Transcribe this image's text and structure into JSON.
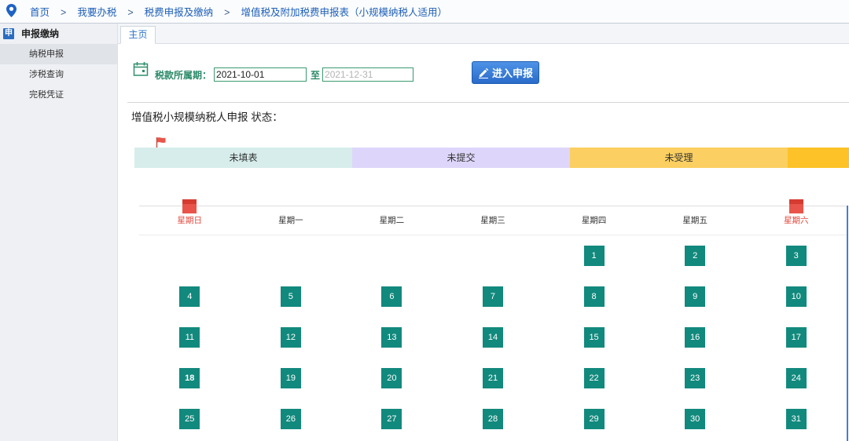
{
  "breadcrumb": {
    "icon": "location-pin-icon",
    "items": [
      "首页",
      "我要办税",
      "税费申报及缴纳",
      "增值税及附加税费申报表（小规模纳税人适用）"
    ],
    "separator": ">"
  },
  "sidebar": {
    "header": {
      "icon_text": "申",
      "label": "申报缴纳"
    },
    "items": [
      {
        "label": "纳税申报",
        "selected": true
      },
      {
        "label": "涉税查询",
        "selected": false
      },
      {
        "label": "完税凭证",
        "selected": false
      }
    ]
  },
  "tabs": [
    {
      "label": "主页",
      "active": true
    }
  ],
  "period": {
    "icon": "calendar-icon",
    "label": "税款所属期：",
    "start": "2021-10-01",
    "to_label": "至",
    "end": "2021-12-31",
    "end_disabled": true
  },
  "declare_button": {
    "icon": "edit-icon",
    "label": "进入申报"
  },
  "status": {
    "title": "增值税小规模纳税人申报 状态：",
    "marker_icon": "flag-icon",
    "steps": [
      {
        "label": "未填表",
        "color": "#d6edeb"
      },
      {
        "label": "未提交",
        "color": "#ded6fa"
      },
      {
        "label": "未受理",
        "color": "#fbcf61"
      },
      {
        "color": "#fcc227"
      }
    ]
  },
  "calendar": {
    "weekdays": [
      "星期日",
      "星期一",
      "星期二",
      "星期三",
      "星期四",
      "星期五",
      "星期六"
    ],
    "weekend_marker_icon": "weekend-marker-icon",
    "weeks": [
      [
        null,
        null,
        null,
        null,
        1,
        2,
        3
      ],
      [
        4,
        5,
        6,
        7,
        8,
        9,
        10
      ],
      [
        11,
        12,
        13,
        14,
        15,
        16,
        17
      ],
      [
        18,
        19,
        20,
        21,
        22,
        23,
        24
      ],
      [
        25,
        26,
        27,
        28,
        29,
        30,
        31
      ]
    ],
    "bold_day": 18
  },
  "colors": {
    "link": "#1d5fb8",
    "accent_green": "#2a8a68",
    "day_cell": "#12897d",
    "weekend": "#e2473c",
    "button": "#2e74d0"
  }
}
